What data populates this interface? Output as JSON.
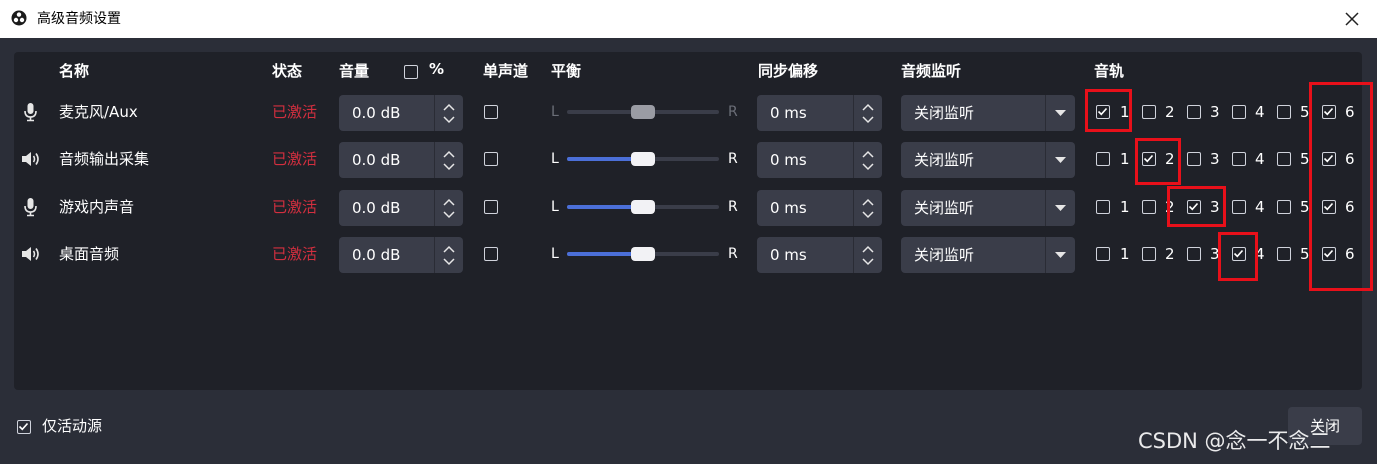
{
  "window": {
    "title": "高级音频设置"
  },
  "headers": {
    "name": "名称",
    "status": "状态",
    "volume": "音量",
    "percent": "%",
    "mono": "单声道",
    "balance": "平衡",
    "sync_offset": "同步偏移",
    "monitoring": "音频监听",
    "tracks": "音轨"
  },
  "sources": [
    {
      "icon": "microphone-icon",
      "name": "麦克风/Aux",
      "status": "已激活",
      "volume": "0.0 dB",
      "mono": false,
      "balance_left": "L",
      "balance_right": "R",
      "balance": 0.5,
      "balance_enabled": false,
      "sync": "0 ms",
      "monitoring": "关闭监听",
      "tracks": [
        true,
        false,
        false,
        false,
        false,
        true
      ]
    },
    {
      "icon": "speaker-icon",
      "name": "音频输出采集",
      "status": "已激活",
      "volume": "0.0 dB",
      "mono": false,
      "balance_left": "L",
      "balance_right": "R",
      "balance": 0.5,
      "balance_enabled": true,
      "sync": "0 ms",
      "monitoring": "关闭监听",
      "tracks": [
        false,
        true,
        false,
        false,
        false,
        true
      ]
    },
    {
      "icon": "microphone-icon",
      "name": "游戏内声音",
      "status": "已激活",
      "volume": "0.0 dB",
      "mono": false,
      "balance_left": "L",
      "balance_right": "R",
      "balance": 0.5,
      "balance_enabled": true,
      "sync": "0 ms",
      "monitoring": "关闭监听",
      "tracks": [
        false,
        false,
        true,
        false,
        false,
        true
      ]
    },
    {
      "icon": "speaker-icon",
      "name": "桌面音频",
      "status": "已激活",
      "volume": "0.0 dB",
      "mono": false,
      "balance_left": "L",
      "balance_right": "R",
      "balance": 0.5,
      "balance_enabled": true,
      "sync": "0 ms",
      "monitoring": "关闭监听",
      "tracks": [
        false,
        false,
        false,
        true,
        false,
        true
      ]
    }
  ],
  "track_numbers": [
    "1",
    "2",
    "3",
    "4",
    "5",
    "6"
  ],
  "footer": {
    "active_only_label": "仅活动源",
    "active_only": true,
    "close_label": "关闭"
  },
  "watermark": "CSDN @念一不念二",
  "colors": {
    "status_active": "#d32f3f",
    "highlight": "#e8101a",
    "balance_fill": "#4b6fd8"
  }
}
